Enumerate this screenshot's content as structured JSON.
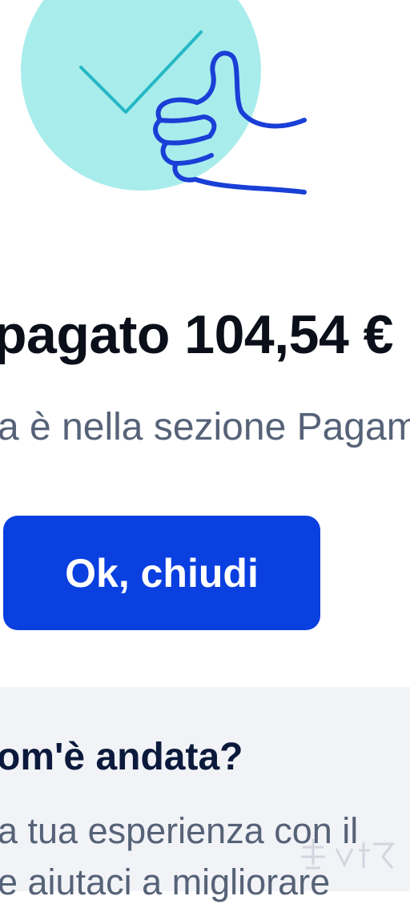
{
  "success": {
    "illustration": "thumbs-up-with-checkmark",
    "title": "pagato 104,54 €",
    "subtitle": "a è nella sezione Pagam"
  },
  "actions": {
    "close_label": "Ok, chiudi"
  },
  "feedback": {
    "title": "om'è andata?",
    "text_line1": "a tua esperienza con il",
    "text_line2": "e aiutaci a migliorare"
  },
  "colors": {
    "primary": "#0a3fe0",
    "circle": "#a9ecec",
    "check": "#23b8c4",
    "panel": "#f2f3f7",
    "heading": "#0b0f1a",
    "muted": "#566277"
  }
}
